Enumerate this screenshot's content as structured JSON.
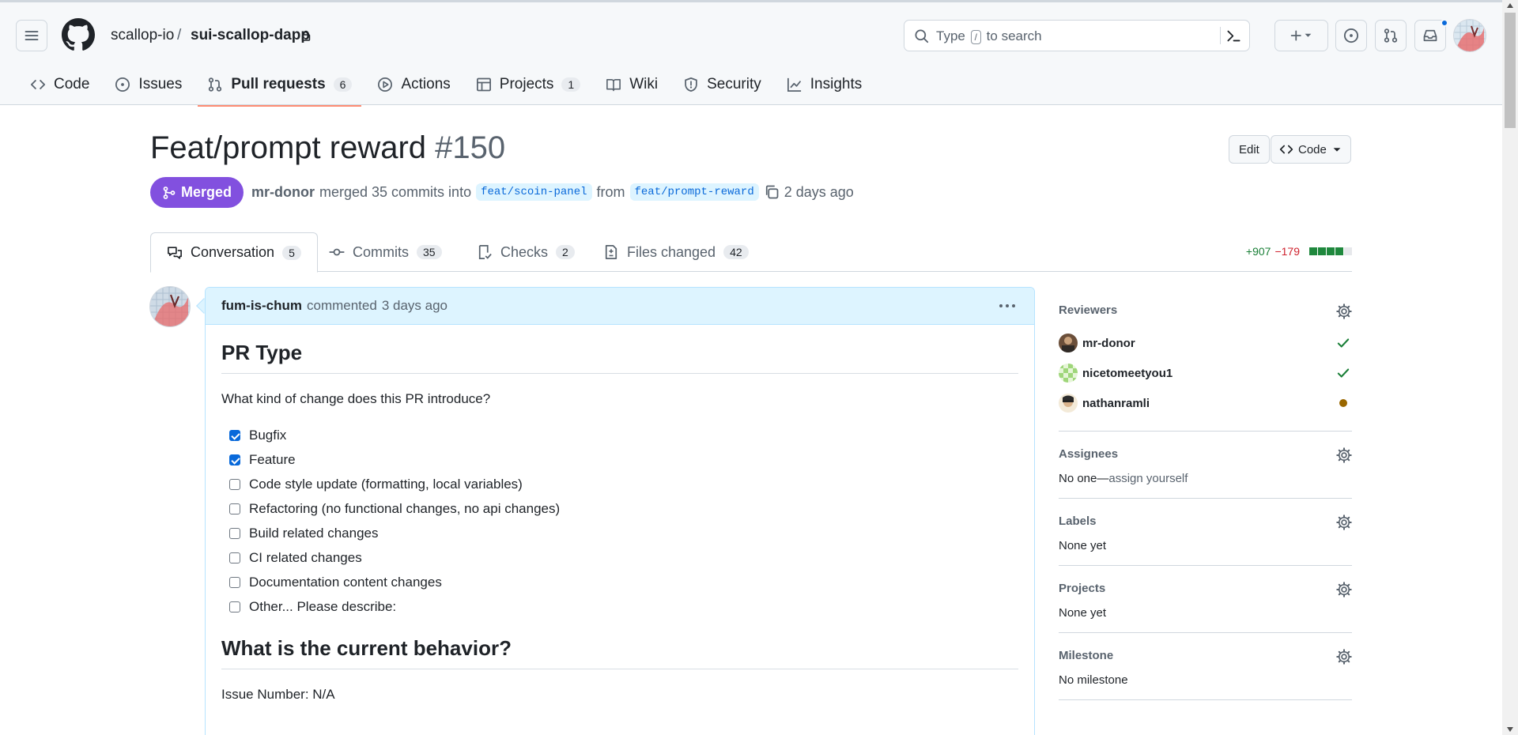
{
  "header": {
    "owner": "scallop-io",
    "separator": "/",
    "repo": "sui-scallop-dapp",
    "search": {
      "prefix": "Type",
      "key": "/",
      "suffix": "to search"
    }
  },
  "nav": [
    {
      "label": "Code",
      "icon": "code-icon"
    },
    {
      "label": "Issues",
      "icon": "issue-icon"
    },
    {
      "label": "Pull requests",
      "icon": "pull-request-icon",
      "count": "6",
      "active": true
    },
    {
      "label": "Actions",
      "icon": "play-icon"
    },
    {
      "label": "Projects",
      "icon": "table-icon",
      "count": "1"
    },
    {
      "label": "Wiki",
      "icon": "book-icon"
    },
    {
      "label": "Security",
      "icon": "shield-icon"
    },
    {
      "label": "Insights",
      "icon": "graph-icon"
    }
  ],
  "pr": {
    "title": "Feat/prompt reward",
    "number": "#150",
    "state": "Merged",
    "author": "mr-donor",
    "action": "merged 35 commits into",
    "base": "feat/scoin-panel",
    "from": "from",
    "head": "feat/prompt-reward",
    "time": "2 days ago",
    "edit_label": "Edit",
    "code_label": "Code"
  },
  "tabs": [
    {
      "label": "Conversation",
      "count": "5",
      "active": true
    },
    {
      "label": "Commits",
      "count": "35"
    },
    {
      "label": "Checks",
      "count": "2"
    },
    {
      "label": "Files changed",
      "count": "42"
    }
  ],
  "diffstat": {
    "additions": "+907",
    "deletions": "−179"
  },
  "comment": {
    "author": "fum-is-chum",
    "action": "commented",
    "time": "3 days ago",
    "heading1": "PR Type",
    "question": "What kind of change does this PR introduce?",
    "tasks": [
      {
        "label": "Bugfix",
        "checked": true
      },
      {
        "label": "Feature",
        "checked": true
      },
      {
        "label": "Code style update (formatting, local variables)",
        "checked": false
      },
      {
        "label": "Refactoring (no functional changes, no api changes)",
        "checked": false
      },
      {
        "label": "Build related changes",
        "checked": false
      },
      {
        "label": "CI related changes",
        "checked": false
      },
      {
        "label": "Documentation content changes",
        "checked": false
      },
      {
        "label": "Other... Please describe:",
        "checked": false
      }
    ],
    "heading2": "What is the current behavior?",
    "issue_line": "Issue Number: N/A"
  },
  "sidebar": {
    "reviewers_title": "Reviewers",
    "reviewers": [
      {
        "name": "mr-donor",
        "state": "approved"
      },
      {
        "name": "nicetomeetyou1",
        "state": "approved"
      },
      {
        "name": "nathanramli",
        "state": "pending"
      }
    ],
    "assignees_title": "Assignees",
    "assignees_value": "No one—",
    "assignees_link": "assign yourself",
    "labels_title": "Labels",
    "labels_value": "None yet",
    "projects_title": "Projects",
    "projects_value": "None yet",
    "milestone_title": "Milestone",
    "milestone_value": "No milestone"
  },
  "colors": {
    "merged": "#8250df",
    "accent": "#0969da",
    "additions": "#1a7f37",
    "deletions": "#cf222e",
    "active_tab_underline": "#fd8c73"
  }
}
